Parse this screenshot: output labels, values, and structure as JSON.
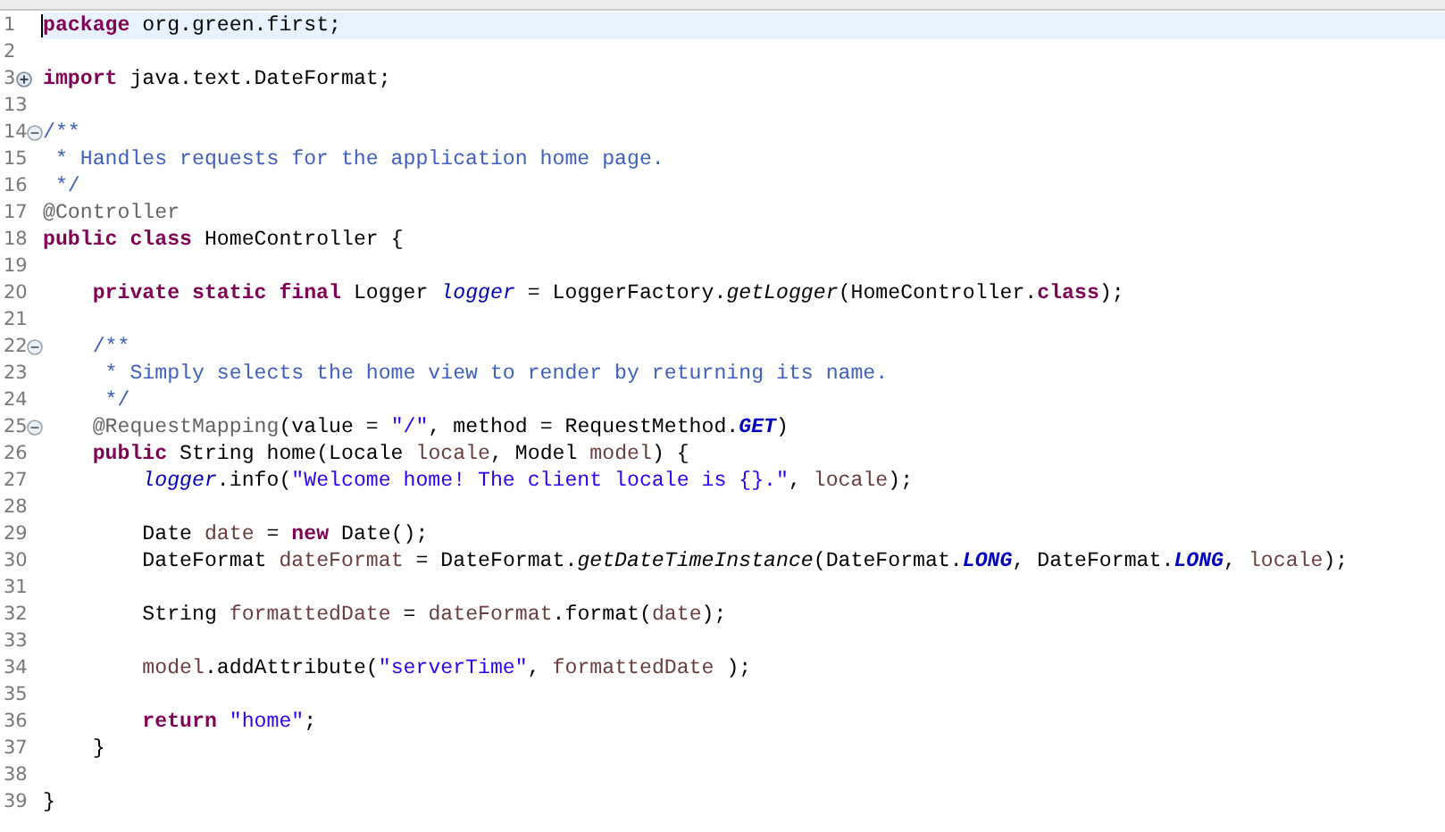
{
  "editor": {
    "lines": [
      {
        "number": "1",
        "current": true,
        "tokens": [
          {
            "kind": "keyword",
            "text": "package"
          },
          {
            "kind": "plain",
            "text": " org.green.first;"
          }
        ]
      },
      {
        "number": "2",
        "current": false
      },
      {
        "number": "3",
        "folded": true,
        "current": false,
        "tokens": [
          {
            "kind": "keyword",
            "text": "import"
          },
          {
            "kind": "plain",
            "text": " java.text.DateFormat;"
          }
        ]
      },
      {
        "number": "13",
        "current": false
      },
      {
        "number": "14",
        "folded": false,
        "current": false,
        "tokens": [
          {
            "kind": "comment",
            "text": "/**"
          }
        ]
      },
      {
        "number": "15",
        "current": false,
        "tokens": [
          {
            "kind": "comment",
            "text": " * Handles requests for the application home page."
          }
        ]
      },
      {
        "number": "16",
        "current": false,
        "tokens": [
          {
            "kind": "comment",
            "text": " */"
          }
        ]
      },
      {
        "number": "17",
        "current": false,
        "tokens": [
          {
            "kind": "annotation",
            "text": "@Controller"
          }
        ]
      },
      {
        "number": "18",
        "current": false,
        "tokens": [
          {
            "kind": "keyword",
            "text": "public class"
          },
          {
            "kind": "plain",
            "text": " HomeController {"
          }
        ]
      },
      {
        "number": "19",
        "current": false
      },
      {
        "number": "20",
        "current": false,
        "tokens": [
          {
            "kind": "keyword",
            "text": "    private static final"
          },
          {
            "kind": "plain",
            "text": " Logger "
          },
          {
            "kind": "field",
            "text": "logger"
          },
          {
            "kind": "plain",
            "text": " = LoggerFactory."
          },
          {
            "kind": "static-method",
            "text": "getLogger"
          },
          {
            "kind": "plain",
            "text": "(HomeController."
          },
          {
            "kind": "keyword",
            "text": "class"
          },
          {
            "kind": "plain",
            "text": ");"
          }
        ]
      },
      {
        "number": "21",
        "current": false
      },
      {
        "number": "22",
        "folded": false,
        "current": false,
        "tokens": [
          {
            "kind": "comment",
            "text": "    /**"
          }
        ]
      },
      {
        "number": "23",
        "current": false,
        "tokens": [
          {
            "kind": "comment",
            "text": "     * Simply selects the home view to render by returning its name."
          }
        ]
      },
      {
        "number": "24",
        "current": false,
        "tokens": [
          {
            "kind": "comment",
            "text": "     */"
          }
        ]
      },
      {
        "number": "25",
        "folded": false,
        "current": false,
        "tokens": [
          {
            "kind": "annotation",
            "text": "    @RequestMapping"
          },
          {
            "kind": "plain",
            "text": "(value = "
          },
          {
            "kind": "string",
            "text": "\"/\""
          },
          {
            "kind": "plain",
            "text": ", method = RequestMethod."
          },
          {
            "kind": "constant",
            "text": "GET"
          },
          {
            "kind": "plain",
            "text": ")"
          }
        ]
      },
      {
        "number": "26",
        "current": false,
        "tokens": [
          {
            "kind": "keyword",
            "text": "    public"
          },
          {
            "kind": "plain",
            "text": " String home(Locale "
          },
          {
            "kind": "local",
            "text": "locale"
          },
          {
            "kind": "plain",
            "text": ", Model "
          },
          {
            "kind": "local",
            "text": "model"
          },
          {
            "kind": "plain",
            "text": ") {"
          }
        ]
      },
      {
        "number": "27",
        "current": false,
        "tokens": [
          {
            "kind": "field",
            "text": "        logger"
          },
          {
            "kind": "plain",
            "text": ".info("
          },
          {
            "kind": "string",
            "text": "\"Welcome home! The client locale is {}.\""
          },
          {
            "kind": "plain",
            "text": ", "
          },
          {
            "kind": "local",
            "text": "locale"
          },
          {
            "kind": "plain",
            "text": ");"
          }
        ]
      },
      {
        "number": "28",
        "current": false
      },
      {
        "number": "29",
        "current": false,
        "tokens": [
          {
            "kind": "plain",
            "text": "        Date "
          },
          {
            "kind": "local",
            "text": "date"
          },
          {
            "kind": "plain",
            "text": " = "
          },
          {
            "kind": "keyword",
            "text": "new"
          },
          {
            "kind": "plain",
            "text": " Date();"
          }
        ]
      },
      {
        "number": "30",
        "current": false,
        "tokens": [
          {
            "kind": "plain",
            "text": "        DateFormat "
          },
          {
            "kind": "local",
            "text": "dateFormat"
          },
          {
            "kind": "plain",
            "text": " = DateFormat."
          },
          {
            "kind": "static-method",
            "text": "getDateTimeInstance"
          },
          {
            "kind": "plain",
            "text": "(DateFormat."
          },
          {
            "kind": "constant",
            "text": "LONG"
          },
          {
            "kind": "plain",
            "text": ", DateFormat."
          },
          {
            "kind": "constant",
            "text": "LONG"
          },
          {
            "kind": "plain",
            "text": ", "
          },
          {
            "kind": "local",
            "text": "locale"
          },
          {
            "kind": "plain",
            "text": ");"
          }
        ]
      },
      {
        "number": "31",
        "current": false
      },
      {
        "number": "32",
        "current": false,
        "tokens": [
          {
            "kind": "plain",
            "text": "        String "
          },
          {
            "kind": "local",
            "text": "formattedDate"
          },
          {
            "kind": "plain",
            "text": " = "
          },
          {
            "kind": "local",
            "text": "dateFormat"
          },
          {
            "kind": "plain",
            "text": ".format("
          },
          {
            "kind": "local",
            "text": "date"
          },
          {
            "kind": "plain",
            "text": ");"
          }
        ]
      },
      {
        "number": "33",
        "current": false
      },
      {
        "number": "34",
        "current": false,
        "tokens": [
          {
            "kind": "local",
            "text": "        model"
          },
          {
            "kind": "plain",
            "text": ".addAttribute("
          },
          {
            "kind": "string",
            "text": "\"serverTime\""
          },
          {
            "kind": "plain",
            "text": ", "
          },
          {
            "kind": "local",
            "text": "formattedDate"
          },
          {
            "kind": "plain",
            "text": " );"
          }
        ]
      },
      {
        "number": "35",
        "current": false
      },
      {
        "number": "36",
        "current": false,
        "tokens": [
          {
            "kind": "keyword",
            "text": "        return "
          },
          {
            "kind": "string",
            "text": "\"home\""
          },
          {
            "kind": "plain",
            "text": ";"
          }
        ]
      },
      {
        "number": "37",
        "current": false,
        "tokens": [
          {
            "kind": "plain",
            "text": "    }"
          }
        ]
      },
      {
        "number": "38",
        "current": false
      },
      {
        "number": "39",
        "current": false,
        "tokens": [
          {
            "kind": "plain",
            "text": "}"
          }
        ]
      }
    ]
  }
}
